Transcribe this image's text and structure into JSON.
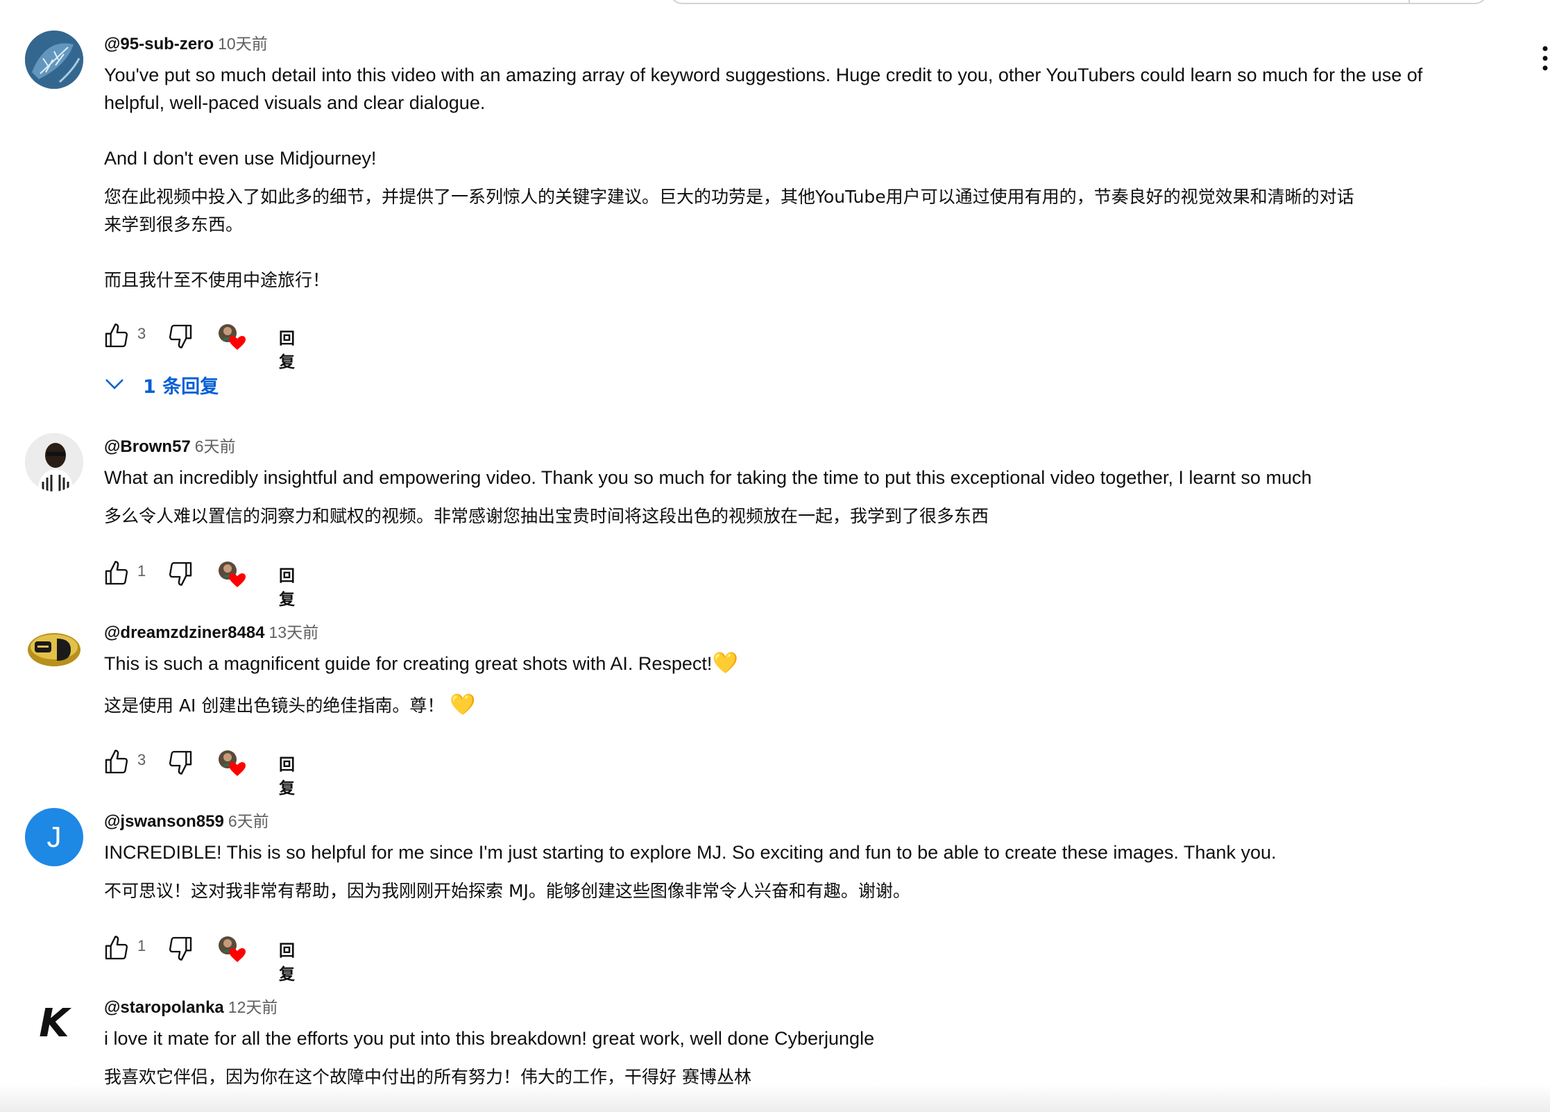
{
  "reply_label": "回复",
  "comments": [
    {
      "author": "@95-sub-zero",
      "time": "10天前",
      "text_en": "You've put so much detail into this video with an amazing array of keyword suggestions. Huge credit to you, other YouTubers could learn so much for the use of\nhelpful, well-paced visuals and clear dialogue.\n\nAnd I don't even use Midjourney!",
      "text_zh": "您在此视频中投入了如此多的细节，并提供了一系列惊人的关键字建议。巨大的功劳是，其他YouTube用户可以通过使用有用的，节奏良好的视觉效果和清晰的对话\n来学到很多东西。\n\n而且我什至不使用中途旅行！",
      "likes": "3",
      "replies_label": "1 条回复"
    },
    {
      "author": "@Brown57",
      "time": "6天前",
      "text_en": "What an incredibly insightful and empowering video. Thank you so much for taking the time to put this exceptional video together, I learnt so much",
      "text_zh": "多么令人难以置信的洞察力和赋权的视频。非常感谢您抽出宝贵时间将这段出色的视频放在一起，我学到了很多东西",
      "likes": "1"
    },
    {
      "author": "@dreamzdziner8484",
      "time": "13天前",
      "text_en": "This is such a magnificent guide for creating great shots with AI. Respect!",
      "text_zh": "这是使用 AI 创建出色镜头的绝佳指南。尊！",
      "emoji": "💛",
      "likes": "3"
    },
    {
      "author": "@jswanson859",
      "time": "6天前",
      "avatar_letter": "J",
      "avatar_color": "#1e88e5",
      "text_en": "INCREDIBLE! This is so helpful for me since I'm just starting to explore MJ. So exciting and fun to be able to create these images. Thank you.",
      "text_zh": "不可思议！这对我非常有帮助，因为我刚刚开始探索 MJ。能够创建这些图像非常令人兴奋和有趣。谢谢。",
      "likes": "1"
    },
    {
      "author": "@staropolanka",
      "time": "12天前",
      "avatar_letter": "K",
      "text_en": "i love it mate for all the efforts you put into this breakdown! great work, well done Cyberjungle",
      "text_zh": "我喜欢它伴侣，因为你在这个故障中付出的所有努力！伟大的工作，干得好 赛博丛林"
    }
  ],
  "colors": {
    "link_blue": "#065fd4",
    "heart_red": "#ff0000",
    "meta_grey": "#606060"
  },
  "icons": [
    "thumbs-up-icon",
    "thumbs-down-icon",
    "creator-heart-icon",
    "chevron-down-icon",
    "more-vert-icon"
  ]
}
